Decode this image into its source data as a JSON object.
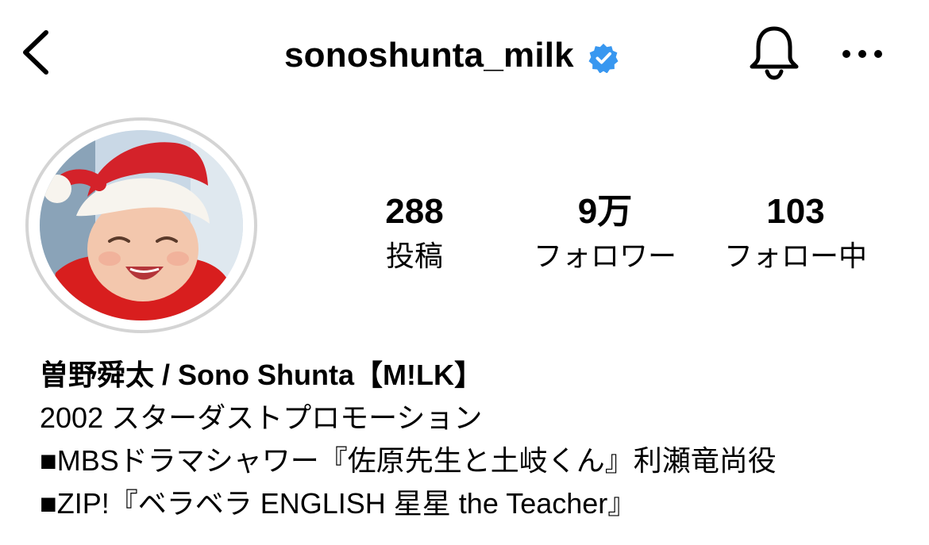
{
  "header": {
    "username": "sonoshunta_milk",
    "back_icon": "chevron-left-icon",
    "verified_icon": "verified-badge-icon",
    "notification_icon": "bell-icon",
    "more_icon": "more-horizontal-icon",
    "verified_color": "#3897f0"
  },
  "profile": {
    "avatar_description": "profile-photo"
  },
  "stats": [
    {
      "value": "288",
      "label": "投稿"
    },
    {
      "value": "9万",
      "label": "フォロワー"
    },
    {
      "value": "103",
      "label": "フォロー中"
    }
  ],
  "bio": {
    "name": "曽野舜太 / Sono Shunta【M!LK】",
    "lines": [
      "2002 スターダストプロモーション",
      "■MBSドラマシャワー『佐原先生と土岐くん』利瀬竜尚役",
      "■ZIP!『ベラベラ ENGLISH 星星 the Teacher』"
    ]
  }
}
